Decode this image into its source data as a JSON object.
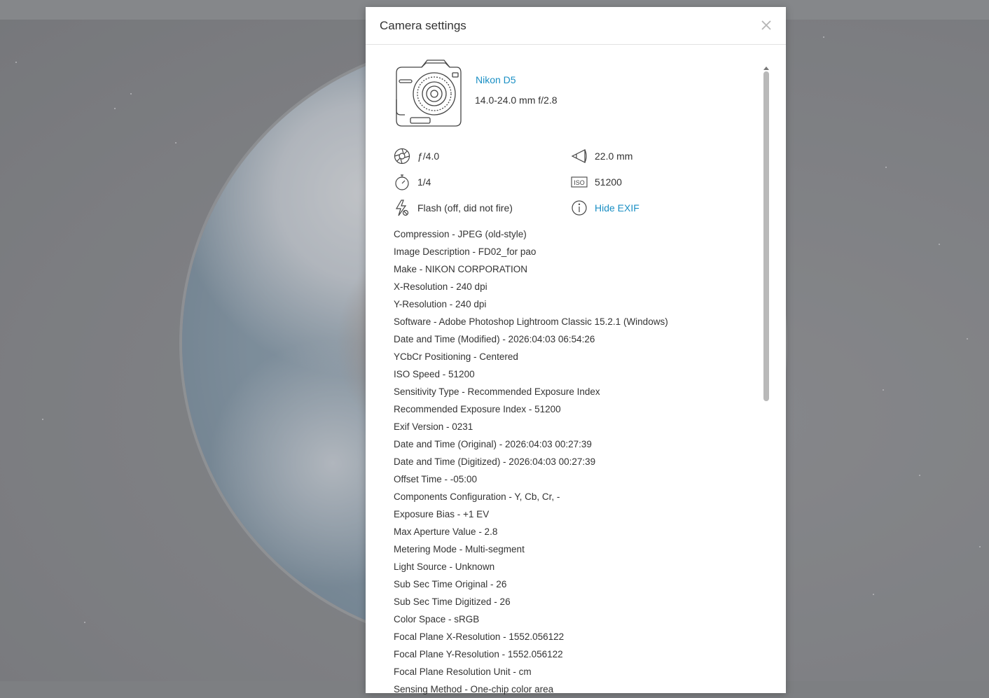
{
  "modal": {
    "title": "Camera settings",
    "camera_name": "Nikon D5",
    "lens": "14.0-24.0 mm f/2.8",
    "specs": {
      "aperture": "ƒ/4.0",
      "focal_length": "22.0 mm",
      "shutter": "1/4",
      "iso": "51200",
      "iso_icon_label": "ISO",
      "flash": "Flash (off, did not fire)",
      "hide_exif": "Hide EXIF"
    },
    "exif": [
      "Compression - JPEG (old-style)",
      "Image Description - FD02_for pao",
      "Make - NIKON CORPORATION",
      "X-Resolution - 240 dpi",
      "Y-Resolution - 240 dpi",
      "Software - Adobe Photoshop Lightroom Classic 15.2.1 (Windows)",
      "Date and Time (Modified) - 2026:04:03 06:54:26",
      "YCbCr Positioning - Centered",
      "ISO Speed - 51200",
      "Sensitivity Type - Recommended Exposure Index",
      "Recommended Exposure Index - 51200",
      "Exif Version - 0231",
      "Date and Time (Original) - 2026:04:03 00:27:39",
      "Date and Time (Digitized) - 2026:04:03 00:27:39",
      "Offset Time - -05:00",
      "Components Configuration - Y, Cb, Cr, -",
      "Exposure Bias - +1 EV",
      "Max Aperture Value - 2.8",
      "Metering Mode - Multi-segment",
      "Light Source - Unknown",
      "Sub Sec Time Original - 26",
      "Sub Sec Time Digitized - 26",
      "Color Space - sRGB",
      "Focal Plane X-Resolution - 1552.056122",
      "Focal Plane Y-Resolution - 1552.056122",
      "Focal Plane Resolution Unit - cm",
      "Sensing Method - One-chip color area"
    ]
  },
  "colors": {
    "link": "#1a8fc4",
    "text": "#333333",
    "scrollbar_thumb": "#b9b9b9"
  },
  "icons": {
    "close": "close-icon",
    "camera": "camera-illustration",
    "aperture": "aperture-icon",
    "focal_length": "lens-icon",
    "shutter": "stopwatch-icon",
    "iso": "iso-icon",
    "flash": "flash-off-icon",
    "info": "info-icon"
  }
}
